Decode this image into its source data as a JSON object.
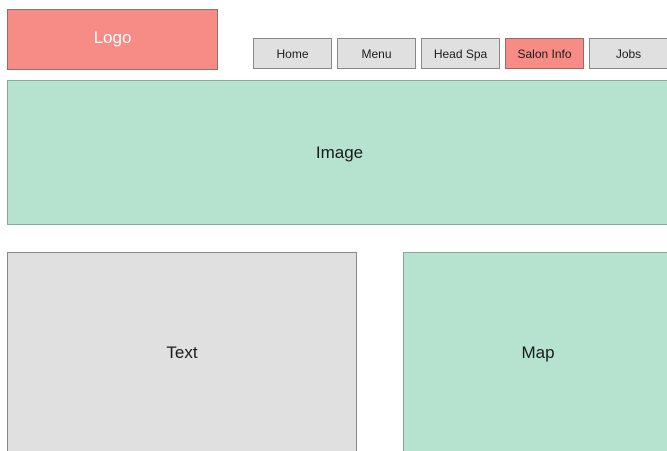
{
  "header": {
    "logo_label": "Logo"
  },
  "nav": {
    "items": [
      {
        "label": "Home"
      },
      {
        "label": "Menu"
      },
      {
        "label": "Head Spa"
      },
      {
        "label": "Salon Info",
        "active": true
      },
      {
        "label": "Jobs"
      }
    ]
  },
  "hero": {
    "label": "Image"
  },
  "content": {
    "text_label": "Text",
    "map_label": "Map"
  },
  "colors": {
    "accent": "#f78b86",
    "image_placeholder": "#b5e3d0",
    "neutral": "#e0e0e0"
  }
}
